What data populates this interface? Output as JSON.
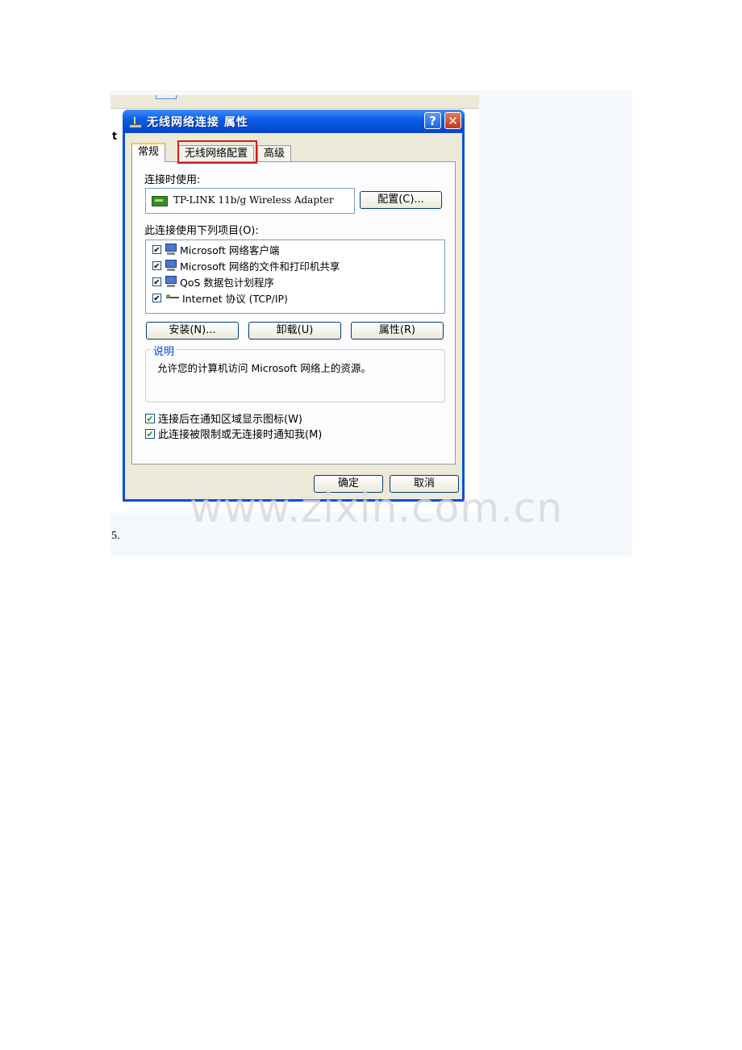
{
  "dialog": {
    "title": "无线网络连接 属性",
    "help_label": "?",
    "close_label": "✕",
    "tabs": [
      "常规",
      "无线网络配置",
      "高级"
    ],
    "connect_using_label": "连接时使用:",
    "adapter_name": "TP-LINK 11b/g Wireless Adapter",
    "configure_label": "配置(C)...",
    "items_label": "此连接使用下列项目(O):",
    "items": [
      {
        "label": "Microsoft 网络客户端",
        "checked": true,
        "icon": "computer-icon"
      },
      {
        "label": "Microsoft 网络的文件和打印机共享",
        "checked": true,
        "icon": "computer-icon"
      },
      {
        "label": "QoS 数据包计划程序",
        "checked": true,
        "icon": "computer-icon"
      },
      {
        "label": "Internet 协议 (TCP/IP)",
        "checked": true,
        "icon": "network-protocol-icon"
      }
    ],
    "install_label": "安装(N)...",
    "uninstall_label": "卸载(U)",
    "properties_label": "属性(R)",
    "description_title": "说明",
    "description_text": "允许您的计算机访问 Microsoft 网络上的资源。",
    "option_show_icon": "连接后在通知区域显示图标(W)",
    "option_notify": "此连接被限制或无连接时通知我(M)",
    "ok_label": "确定",
    "cancel_label": "取消",
    "check_mark": "✔"
  },
  "background": {
    "fragment_t": "t"
  },
  "watermark": "www.zixin.com.cn",
  "step_number": "5.",
  "colors": {
    "titlebar": "#0a5fe8",
    "highlight_box": "#d11c1c",
    "legend": "#0046d5"
  }
}
